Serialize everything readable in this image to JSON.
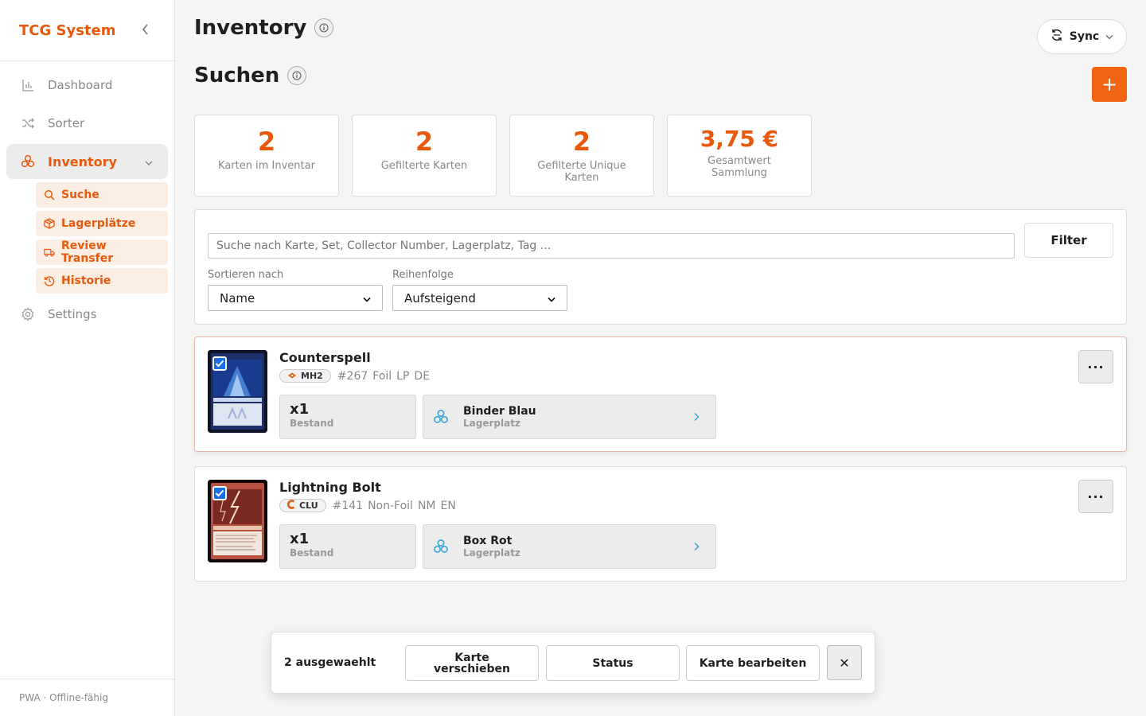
{
  "sidebar": {
    "brand": "TCG System",
    "collapse_icon": "chevron-left-icon",
    "items": [
      {
        "label": "Dashboard",
        "icon": "bar-chart-icon"
      },
      {
        "label": "Sorter",
        "icon": "shuffle-icon"
      },
      {
        "label": "Inventory",
        "icon": "boxes-icon",
        "active": true
      },
      {
        "label": "Settings",
        "icon": "gear-icon"
      }
    ],
    "sub_items": [
      {
        "label": "Suche",
        "icon": "search-icon"
      },
      {
        "label": "Lagerplätze",
        "icon": "package-icon"
      },
      {
        "label": "Review Transfer",
        "icon": "truck-icon"
      },
      {
        "label": "Historie",
        "icon": "history-icon"
      }
    ],
    "footer": "PWA · Offline-fähig"
  },
  "header": {
    "title": "Inventory",
    "subtitle": "Suchen",
    "sync_label": "Sync",
    "add_label": "+"
  },
  "stats": [
    {
      "value": "2",
      "label": "Karten im Inventar"
    },
    {
      "value": "2",
      "label": "Gefilterte Karten"
    },
    {
      "value": "2",
      "label": "Gefilterte Unique Karten"
    },
    {
      "value": "3,75 €",
      "label": "Gesamtwert Sammlung"
    }
  ],
  "search": {
    "placeholder": "Suche nach Karte, Set, Collector Number, Lagerplatz, Tag ...",
    "filter_label": "Filter",
    "sort_label": "Sortieren nach",
    "sort_value": "Name",
    "order_label": "Reihenfolge",
    "order_value": "Aufsteigend"
  },
  "cards": [
    {
      "name": "Counterspell",
      "set": "MH2",
      "number": "#267",
      "finish": "Foil",
      "condition": "LP",
      "language": "DE",
      "qty": "x1",
      "qty_label": "Bestand",
      "location": "Binder Blau",
      "location_label": "Lagerplatz",
      "selected": true,
      "more_label": "···"
    },
    {
      "name": "Lightning Bolt",
      "set": "CLU",
      "number": "#141",
      "finish": "Non-Foil",
      "condition": "NM",
      "language": "EN",
      "qty": "x1",
      "qty_label": "Bestand",
      "location": "Box Rot",
      "location_label": "Lagerplatz",
      "selected": true,
      "more_label": "···"
    }
  ],
  "bulk": {
    "selected_label": "2 ausgewaehlt",
    "move_label": "Karte verschieben",
    "status_label": "Status",
    "edit_label": "Karte bearbeiten",
    "close_label": "✕"
  },
  "colors": {
    "accent": "#e8590c",
    "link": "#3ba8d8",
    "check": "#1a6fe8"
  }
}
